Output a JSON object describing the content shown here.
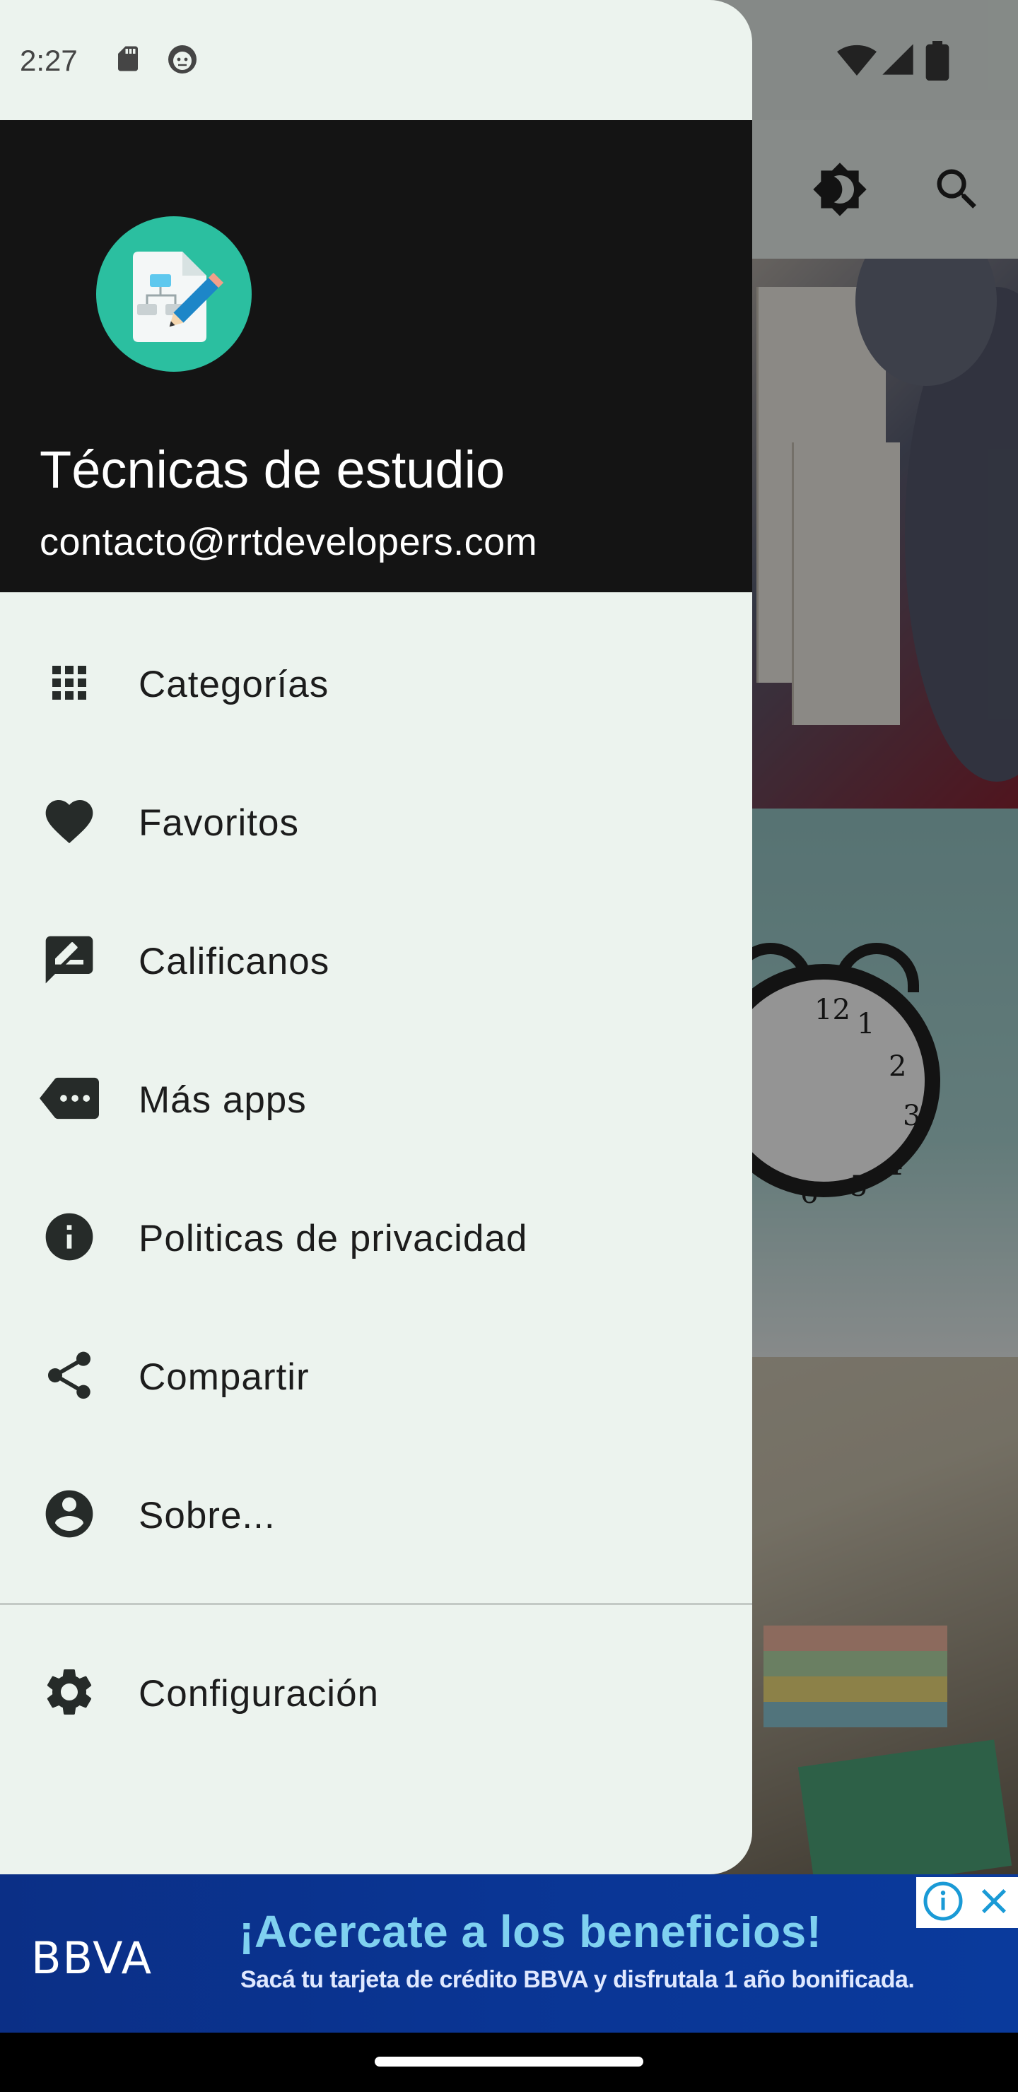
{
  "status_bar": {
    "time": "2:27",
    "icons_left": [
      "sd-card-icon",
      "debug-cat-icon"
    ],
    "icons_right": [
      "wifi-icon",
      "signal-icon",
      "battery-icon"
    ]
  },
  "app_bar": {
    "actions": [
      "theme-toggle-icon",
      "search-icon"
    ]
  },
  "drawer": {
    "header": {
      "app_name": "Técnicas de estudio",
      "email": "contacto@rrtdevelopers.com",
      "logo_icon": "document-edit-icon",
      "logo_color": "#2bbfa0"
    },
    "items": [
      {
        "label": "Categorías",
        "icon": "grid-icon"
      },
      {
        "label": "Favoritos",
        "icon": "heart-icon"
      },
      {
        "label": "Calificanos",
        "icon": "rate-review-icon"
      },
      {
        "label": "Más apps",
        "icon": "more-apps-icon"
      },
      {
        "label": "Politicas de privacidad",
        "icon": "info-icon"
      },
      {
        "label": "Compartir",
        "icon": "share-icon"
      },
      {
        "label": "Sobre...",
        "icon": "account-circle-icon"
      }
    ],
    "footer_items": [
      {
        "label": "Configuración",
        "icon": "settings-icon"
      }
    ],
    "background": "#ecf3ee"
  },
  "ad": {
    "brand": "BBVA",
    "headline": "¡Acercate a los beneficios!",
    "subtext": "Sacá tu tarjeta de crédito BBVA y disfrutala 1 año bonificada.",
    "background": "#0b2f86"
  }
}
